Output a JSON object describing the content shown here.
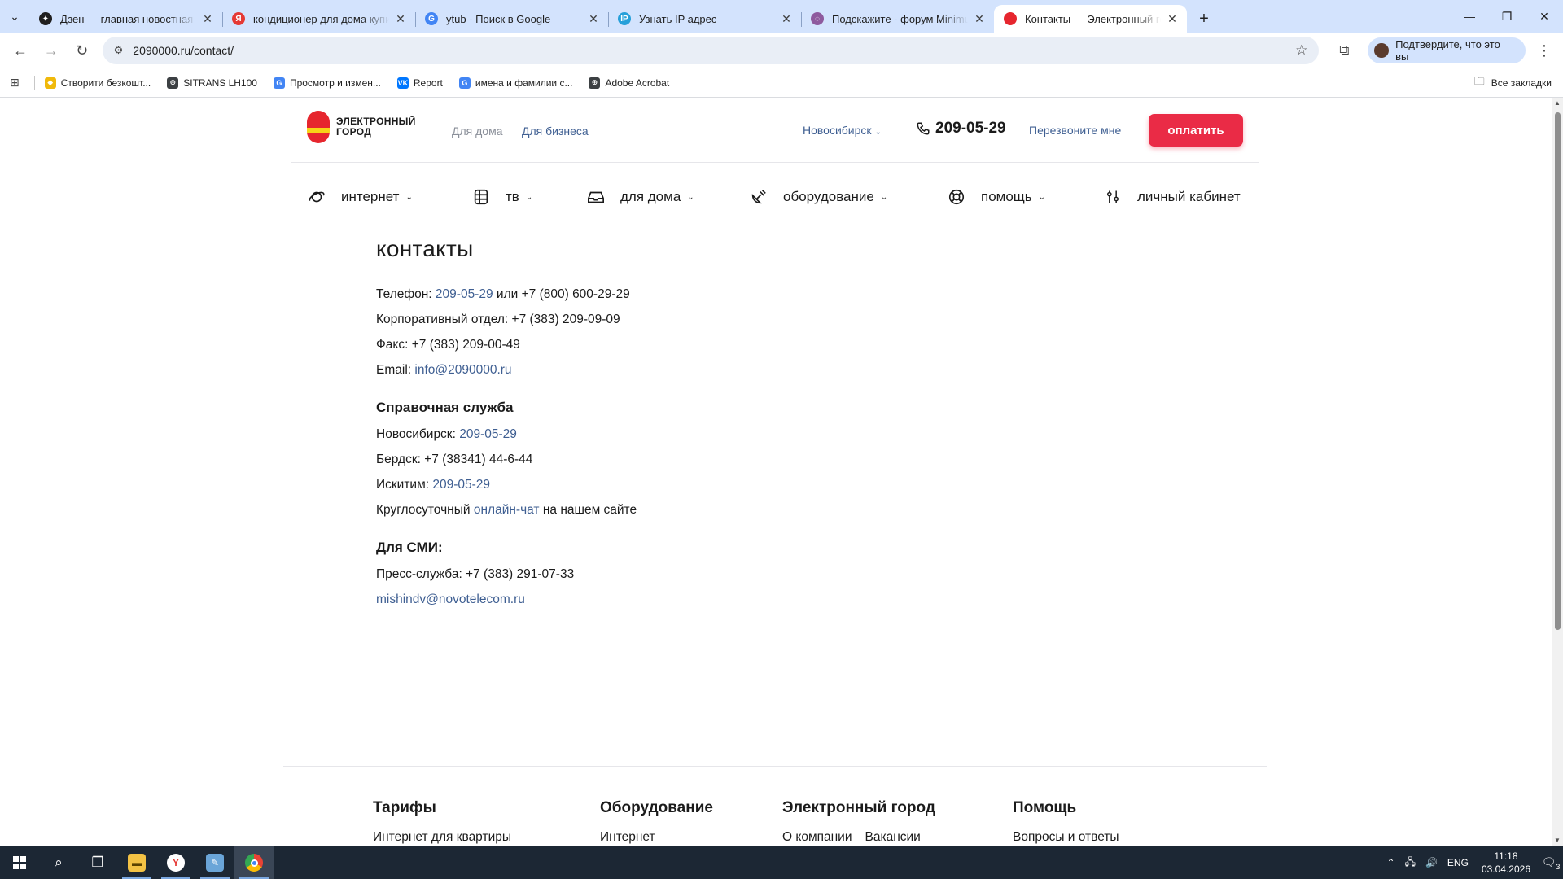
{
  "browser": {
    "tabs": [
      {
        "title": "Дзен — главная новостная и...",
        "favicon_color": "#1f1f1f",
        "favicon_glyph": "✦",
        "active": false
      },
      {
        "title": "кондиционер для дома купить",
        "favicon_color": "#e53935",
        "favicon_glyph": "Я",
        "active": false
      },
      {
        "title": "ytub - Поиск в Google",
        "favicon_color": "#4285f4",
        "favicon_glyph": "G",
        "active": false
      },
      {
        "title": "Узнать IP адрес",
        "favicon_color": "#26a0da",
        "favicon_glyph": "IP",
        "active": false
      },
      {
        "title": "Подскажите - форум Minimum",
        "favicon_color": "#8e5a9e",
        "favicon_glyph": "◌",
        "active": false
      },
      {
        "title": "Контакты — Электронный город",
        "favicon_color": "#e6262e",
        "favicon_glyph": "",
        "active": true
      }
    ],
    "url": "2090000.ru/contact/",
    "profile_label": "Подтвердите, что это вы",
    "bookmarks": [
      {
        "label": "Створити безкошт...",
        "icon_color": "#f0b90b",
        "glyph": "◆"
      },
      {
        "label": "SITRANS LH100",
        "icon_color": "#3c4043",
        "glyph": "⊕"
      },
      {
        "label": "Просмотр и измен...",
        "icon_color": "#4285f4",
        "glyph": "G"
      },
      {
        "label": "Report",
        "icon_color": "#0077ff",
        "glyph": "VK"
      },
      {
        "label": "имена и фамилии с...",
        "icon_color": "#4285f4",
        "glyph": "G"
      },
      {
        "label": "Adobe Acrobat",
        "icon_color": "#3c4043",
        "glyph": "⊕"
      }
    ],
    "all_bookmarks_label": "Все закладки"
  },
  "site": {
    "logo_text_line1": "ЭЛЕКТРОННЫЙ",
    "logo_text_line2": "ГОРОД",
    "segment_home": "Для дома",
    "segment_business": "Для бизнеса",
    "city": "Новосибирск",
    "phone": "209-05-29",
    "callback": "Перезвоните мне",
    "pay_button": "оплатить",
    "nav": [
      {
        "label": "интернет",
        "icon": "planet-icon"
      },
      {
        "label": "тв",
        "icon": "tv-icon"
      },
      {
        "label": "для дома",
        "icon": "home-device-icon"
      },
      {
        "label": "оборудование",
        "icon": "satellite-icon"
      },
      {
        "label": "помощь",
        "icon": "lifebuoy-icon"
      },
      {
        "label": "личный кабинет",
        "icon": "sliders-icon"
      }
    ],
    "accent_color": "#ea2b46",
    "link_color": "#3f5f92"
  },
  "contacts": {
    "title": "контакты",
    "phone_label": "Телефон:",
    "phone_main": "209-05-29",
    "phone_or": "или",
    "phone_alt": "+7 (800) 600-29-29",
    "corporate": "Корпоративный отдел: +7 (383) 209-09-09",
    "fax": "Факс: +7 (383) 209-00-49",
    "email_label": "Email:",
    "email": "info@2090000.ru",
    "help_title": "Справочная служба",
    "nsk_label": "Новосибирск:",
    "nsk_phone": "209-05-29",
    "berdsk": "Бердск: +7 (38341) 44-6-44",
    "iskitim_label": "Искитим:",
    "iskitim_phone": "209-05-29",
    "chat_prefix": "Круглосуточный",
    "chat_link": "онлайн-чат",
    "chat_suffix": "на нашем сайте",
    "media_title": "Для СМИ:",
    "press": "Пресс-служба: +7 (383) 291-07-33",
    "press_email": "mishindv@novotelecom.ru"
  },
  "footer": {
    "col1_title": "Тарифы",
    "col1_link": "Интернет для квартиры",
    "col2_title": "Оборудование",
    "col2_link": "Интернет",
    "col3_title": "Электронный город",
    "col3_link1": "О компании",
    "col3_link2": "Вакансии",
    "col4_title": "Помощь",
    "col4_link": "Вопросы и ответы"
  },
  "taskbar": {
    "lang": "ENG",
    "time": "11:18",
    "date": "03.04.2026",
    "notifications": "3"
  }
}
